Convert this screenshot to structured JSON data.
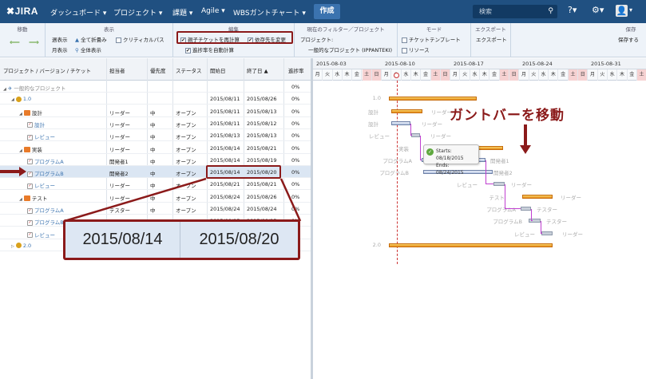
{
  "topnav": {
    "logo": "JIRA",
    "items": [
      "ダッシュボード ▾",
      "プロジェクト ▾",
      "課題 ▾",
      "Agile ▾",
      "WBSガントチャート ▾"
    ],
    "create_label": "作成",
    "search_placeholder": "検索"
  },
  "toolbar": {
    "move": {
      "title": "移動"
    },
    "display": {
      "title": "表示",
      "week": "週表示",
      "month": "月表示",
      "collapse_all": "全て折畳み",
      "show_all": "全体表示",
      "critical_path": "クリティカルパス"
    },
    "edit": {
      "title": "編集",
      "recalc_parent": "親子チケットを再計算",
      "change_deps": "依存先を変更",
      "auto_progress": "進捗率を自動計算"
    },
    "filter": {
      "title": "現在のフィルター／プロジェクト",
      "project_label": "プロジェクト:",
      "project_value": "一般的なプロジェクト (IPPANTEKI)"
    },
    "mode": {
      "title": "モード",
      "template": "チケットテンプレート",
      "resource": "リソース"
    },
    "export": {
      "title": "エクスポート",
      "label": "エクスポート"
    },
    "save": {
      "title": "保存",
      "label": "保存する"
    }
  },
  "grid": {
    "headers": [
      "プロジェクト / バージョン / チケット",
      "担当者",
      "優先度",
      "ステータス",
      "開始日",
      "終了日 ▲",
      "進捗率"
    ],
    "rows": [
      {
        "name": "一般的なプロジェクト",
        "assignee": "",
        "priority": "",
        "status": "",
        "start": "",
        "end": "",
        "progress": "0%"
      },
      {
        "name": "1.0",
        "assignee": "",
        "priority": "",
        "status": "",
        "start": "2015/08/11",
        "end": "2015/08/26",
        "progress": "0%"
      },
      {
        "name": "設計",
        "assignee": "リーダー",
        "priority": "中",
        "status": "オープン",
        "start": "2015/08/11",
        "end": "2015/08/13",
        "progress": "0%"
      },
      {
        "name": "設計",
        "assignee": "リーダー",
        "priority": "中",
        "status": "オープン",
        "start": "2015/08/11",
        "end": "2015/08/12",
        "progress": "0%"
      },
      {
        "name": "レビュー",
        "assignee": "リーダー",
        "priority": "中",
        "status": "オープン",
        "start": "2015/08/13",
        "end": "2015/08/13",
        "progress": "0%"
      },
      {
        "name": "実装",
        "assignee": "リーダー",
        "priority": "中",
        "status": "オープン",
        "start": "2015/08/14",
        "end": "2015/08/21",
        "progress": "0%"
      },
      {
        "name": "プログラムA",
        "assignee": "開発者1",
        "priority": "中",
        "status": "オープン",
        "start": "2015/08/14",
        "end": "2015/08/19",
        "progress": "0%"
      },
      {
        "name": "プログラムB",
        "assignee": "開発者2",
        "priority": "中",
        "status": "オープン",
        "start": "2015/08/14",
        "end": "2015/08/20",
        "progress": "0%"
      },
      {
        "name": "レビュー",
        "assignee": "リーダー",
        "priority": "中",
        "status": "オープン",
        "start": "2015/08/21",
        "end": "2015/08/21",
        "progress": "0%"
      },
      {
        "name": "テスト",
        "assignee": "リーダー",
        "priority": "中",
        "status": "オープン",
        "start": "2015/08/24",
        "end": "2015/08/26",
        "progress": "0%"
      },
      {
        "name": "プログラムA",
        "assignee": "テスター",
        "priority": "中",
        "status": "オープン",
        "start": "2015/08/24",
        "end": "2015/08/24",
        "progress": "0%"
      },
      {
        "name": "プログラムB",
        "assignee": "テスター",
        "priority": "中",
        "status": "オープン",
        "start": "2015/08/25",
        "end": "2015/08/25",
        "progress": "0%"
      },
      {
        "name": "レビュー",
        "assignee": "リーダー",
        "priority": "中",
        "status": "オープン",
        "start": "2015/08/26",
        "end": "2015/08/26",
        "progress": "0%"
      },
      {
        "name": "2.0",
        "assignee": "",
        "priority": "",
        "status": "",
        "start": "",
        "end": "",
        "progress": "0%"
      }
    ]
  },
  "gantt": {
    "weeks": [
      "2015-08-03",
      "2015-08-10",
      "2015-08-17",
      "2015-08-24",
      "2015-08-31"
    ],
    "days": [
      "月",
      "火",
      "水",
      "木",
      "金",
      "土",
      "日",
      "月",
      "火",
      "水",
      "木",
      "金",
      "土",
      "日",
      "月",
      "火",
      "水",
      "木",
      "金",
      "土",
      "日",
      "月",
      "火",
      "水",
      "木",
      "金",
      "土",
      "日",
      "月",
      "火",
      "水",
      "木",
      "金",
      "土",
      "日",
      "月",
      "火",
      "水",
      "木",
      "金",
      "土",
      "日",
      "月",
      "火",
      "水",
      "木",
      "金",
      "土",
      "日"
    ],
    "tooltip_start": "Starts: 08/18/2015",
    "tooltip_end": "Ends: 08/24/2015",
    "callout": "ガントバーを移動",
    "labels": [
      "1.0",
      "設計",
      "リーダー",
      "設計",
      "リーダー",
      "レビュー",
      "リーダー",
      "実装",
      "プログラムA",
      "開発者1",
      "プログラムB",
      "開発者2",
      "レビュー",
      "リーダー",
      "テスト",
      "リーダー",
      "プログラムA",
      "テスター",
      "プログラムB",
      "テスター",
      "レビュー",
      "リーダー",
      "2.0"
    ]
  },
  "zoom": {
    "start": "2015/08/14",
    "end": "2015/08/20"
  }
}
